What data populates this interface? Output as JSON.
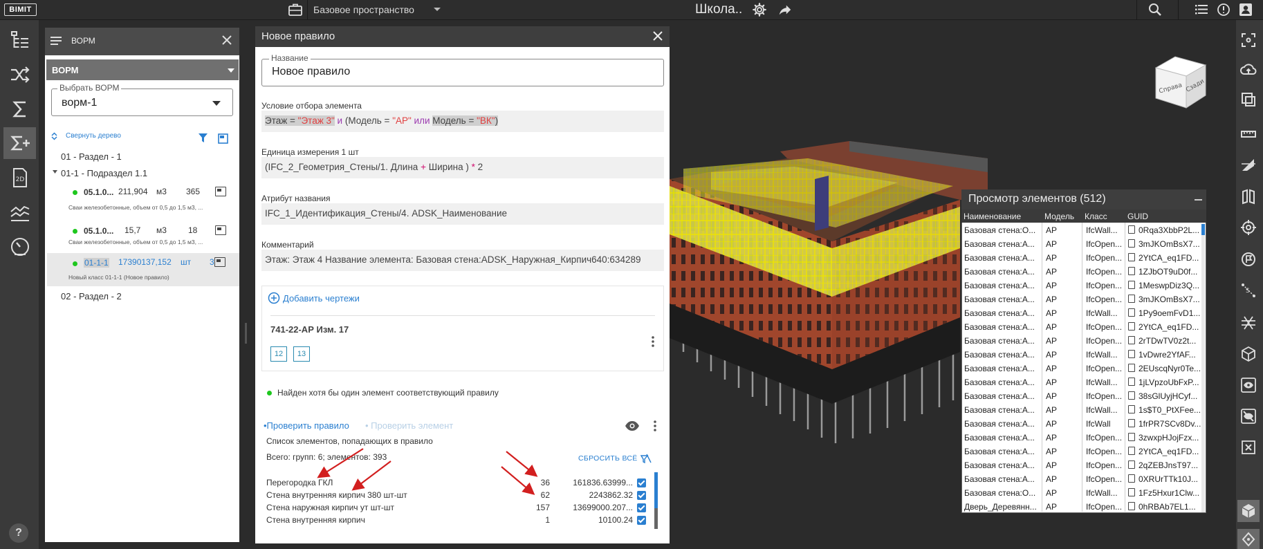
{
  "topbar": {
    "logo": "BIMIT",
    "workspace": "Базовое пространство",
    "project_title": "Школа.."
  },
  "vorm_panel": {
    "title": "ВОРМ",
    "dropdown_label": "ВОРМ",
    "select_legend": "Выбрать ВОРМ",
    "select_value": "ворм-1",
    "collapse_link": "Свернуть дерево",
    "tree": {
      "section1": "01 - Раздел - 1",
      "subsection1": "01-1 - Подраздел 1.1",
      "rows": [
        {
          "code": "05.1.0...",
          "value": "211,904",
          "unit": "м3",
          "count": "365",
          "desc": "Сваи железобетонные, объем от 0,5 до 1,5 м3, ..."
        },
        {
          "code": "05.1.0...",
          "value": "15,7",
          "unit": "м3",
          "count": "18",
          "desc": "Сваи железобетонные, объем от 0,5 до 1,5 м3, ..."
        },
        {
          "code": "01-1-1",
          "value": "17390137,152",
          "unit": "шт",
          "count": "3",
          "desc": "Новый класс 01-1-1 (Новое правило)"
        }
      ],
      "section2": "02 - Раздел - 2"
    }
  },
  "rule": {
    "title": "Новое правило",
    "name_legend": "Название",
    "name_value": "Новое правило",
    "condition_label": "Условие отбора элемента",
    "condition_tokens": {
      "a1": "Этаж",
      "a2": " = ",
      "a3": "\"Этаж 3\"",
      "b1": " и ",
      "b2": "(Модель",
      "b3": " = ",
      "b4": "\"АР\"",
      "b5": " или ",
      "c1": "Модель",
      "c2": " = ",
      "c3": "\"ВК\"",
      "c4": ")"
    },
    "unit_label": "Единица измерения 1 шт",
    "unit_tokens": {
      "t1": "(IFC_2_Геометрия_Стены/1. Длина ",
      "t2": "+",
      "t3": " Ширина ) ",
      "t4": "*",
      "t5": " 2"
    },
    "name_attr_label": "Атрибут названия",
    "name_attr_value": "IFC_1_Идентификация_Стены/4. ADSK_Наименование",
    "comment_label": "Комментарий",
    "comment_value": "Этаж: Этаж 4 Название элемента: Базовая стена:ADSK_Наружная_Кирпич640:634289",
    "add_drawings": "Добавить чертежи",
    "drawing_name": "741-22-АР Изм. 17",
    "sheets": [
      "12",
      "13"
    ],
    "found_text": "Найден хотя бы один элемент соответствующий правилу",
    "check_rule": "•Проверить правило",
    "check_element": "• Проверить элемент",
    "elements_list_title": "Список элементов, попадающих в правило",
    "elements_total": "Всего: групп: 6; элементов: 393",
    "reset_all": "СБРОСИТЬ ВСЁ",
    "elements": [
      {
        "name": "Перегородка ГКЛ",
        "count": "36",
        "value": "161836.63999..."
      },
      {
        "name": "Стена внутренняя кирпич 380 шт-шт",
        "count": "62",
        "value": "2243862.32"
      },
      {
        "name": "Стена наружная кирпич ут шт-шт",
        "count": "157",
        "value": "13699000.207..."
      },
      {
        "name": "Стена внутренняя кирпич",
        "count": "1",
        "value": "10100.24"
      }
    ]
  },
  "viewcube": {
    "left_face": "Справа",
    "front_face": "Сзади"
  },
  "element_viewer": {
    "title": "Просмотр элементов (512)",
    "columns": [
      "Наименование",
      "Модель",
      "Класс",
      "GUID"
    ],
    "rows": [
      {
        "name": "Базовая стена:О...",
        "model": "АР",
        "cls": "IfcWall...",
        "guid": "0Rqa3XbbP2L..."
      },
      {
        "name": "Базовая стена:А...",
        "model": "АР",
        "cls": "IfcOpen...",
        "guid": "3mJKOmBsX7..."
      },
      {
        "name": "Базовая стена:А...",
        "model": "АР",
        "cls": "IfcOpen...",
        "guid": "2YtCA_eq1FD..."
      },
      {
        "name": "Базовая стена:А...",
        "model": "АР",
        "cls": "IfcOpen...",
        "guid": "1ZJbOT9uD0f..."
      },
      {
        "name": "Базовая стена:А...",
        "model": "АР",
        "cls": "IfcOpen...",
        "guid": "1MeswpDiz3Q..."
      },
      {
        "name": "Базовая стена:А...",
        "model": "АР",
        "cls": "IfcOpen...",
        "guid": "3mJKOmBsX7..."
      },
      {
        "name": "Базовая стена:А...",
        "model": "АР",
        "cls": "IfcWall...",
        "guid": "1Py9oemFvD1..."
      },
      {
        "name": "Базовая стена:А...",
        "model": "АР",
        "cls": "IfcOpen...",
        "guid": "2YtCA_eq1FD..."
      },
      {
        "name": "Базовая стена:А...",
        "model": "АР",
        "cls": "IfcOpen...",
        "guid": "2rTDwTV0z2t..."
      },
      {
        "name": "Базовая стена:А...",
        "model": "АР",
        "cls": "IfcWall...",
        "guid": "1vDwre2YfAF..."
      },
      {
        "name": "Базовая стена:А...",
        "model": "АР",
        "cls": "IfcOpen...",
        "guid": "2EUscqNyr0Te..."
      },
      {
        "name": "Базовая стена:А...",
        "model": "АР",
        "cls": "IfcWall...",
        "guid": "1jLVpzoUbFxP..."
      },
      {
        "name": "Базовая стена:А...",
        "model": "АР",
        "cls": "IfcOpen...",
        "guid": "38sGlUyjHCyf..."
      },
      {
        "name": "Базовая стена:А...",
        "model": "АР",
        "cls": "IfcWall...",
        "guid": "1s$T0_PtXFee..."
      },
      {
        "name": "Базовая стена:А...",
        "model": "АР",
        "cls": "IfcWall",
        "guid": "1frPR7SCv8Dv..."
      },
      {
        "name": "Базовая стена:А...",
        "model": "АР",
        "cls": "IfcOpen...",
        "guid": "3zwxpHJojFzx..."
      },
      {
        "name": "Базовая стена:А...",
        "model": "АР",
        "cls": "IfcOpen...",
        "guid": "2YtCA_eq1FD..."
      },
      {
        "name": "Базовая стена:А...",
        "model": "АР",
        "cls": "IfcOpen...",
        "guid": "2qZEBJnsT97..."
      },
      {
        "name": "Базовая стена:А...",
        "model": "АР",
        "cls": "IfcOpen...",
        "guid": "0XRUrTTk10J..."
      },
      {
        "name": "Базовая стена:О...",
        "model": "АР",
        "cls": "IfcWall...",
        "guid": "1Fz5Hxur1Clw..."
      },
      {
        "name": "Дверь_Деревянн...",
        "model": "АР",
        "cls": "IfcOpen...",
        "guid": "0hRBAb7EL1..."
      }
    ]
  }
}
